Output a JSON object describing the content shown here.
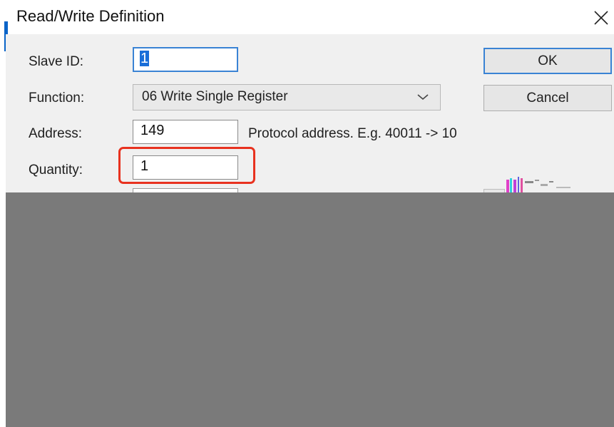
{
  "window": {
    "title": "Read/Write Definition",
    "close_icon": "close-icon"
  },
  "form": {
    "slave_id": {
      "label": "Slave ID:",
      "value": "1"
    },
    "function": {
      "label": "Function:",
      "value": "06 Write Single Register",
      "icon": "chevron-down-icon"
    },
    "address": {
      "label": "Address:",
      "value": "149",
      "hint": "Protocol address. E.g. 40011 -> 10"
    },
    "quantity": {
      "label": "Quantity:",
      "value": "1"
    }
  },
  "buttons": {
    "ok": "OK",
    "cancel": "Cancel"
  },
  "colors": {
    "accent": "#3a83d4",
    "highlight": "#e8321f",
    "redacted": "#7a7a7a",
    "panel": "#f0f0f0"
  }
}
